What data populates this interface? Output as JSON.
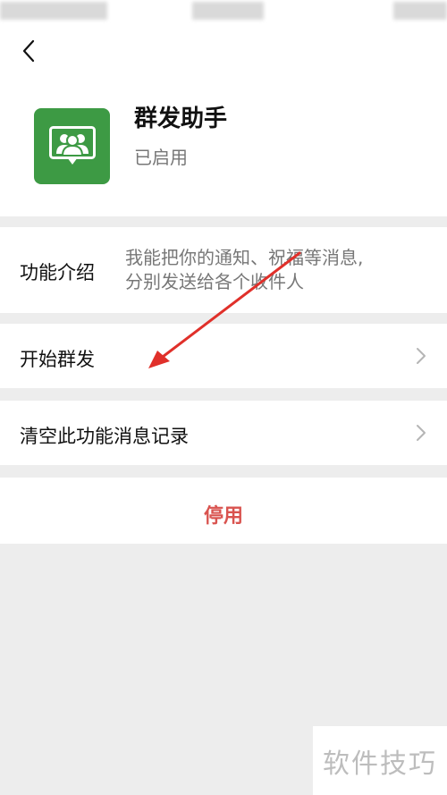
{
  "app": {
    "title": "群发助手",
    "status": "已启用"
  },
  "rows": {
    "intro_label": "功能介绍",
    "intro_desc_line1": "我能把你的通知、祝福等消息,",
    "intro_desc_line2": "分别发送给各个收件人",
    "start_label": "开始群发",
    "clear_label": "清空此功能消息记录"
  },
  "actions": {
    "disable_label": "停用"
  },
  "watermark": "软件技巧",
  "icons": {
    "back": "chevron-left-icon",
    "app": "group-broadcast-icon",
    "row_arrow": "chevron-right-icon"
  },
  "colors": {
    "app_icon_bg": "#3d9a44",
    "disable_text": "#d9534f",
    "annotation_arrow": "#e0302a",
    "page_bg": "#ededed"
  }
}
